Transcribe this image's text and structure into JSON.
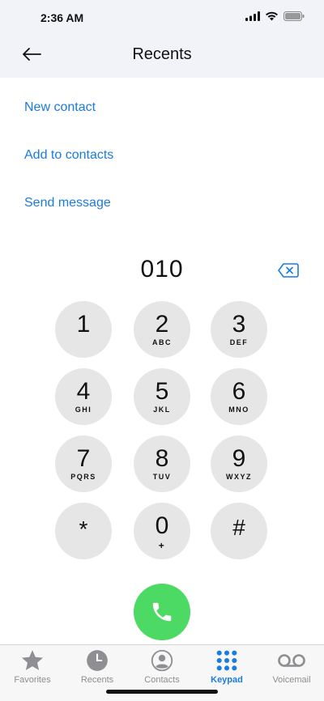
{
  "status_bar": {
    "time": "2:36 AM"
  },
  "nav": {
    "title": "Recents"
  },
  "actions": {
    "new_contact": "New contact",
    "add_to_contacts": "Add to contacts",
    "send_message": "Send message"
  },
  "dialer": {
    "entered_number": "010"
  },
  "keypad": {
    "k1": {
      "digit": "1",
      "letters": ""
    },
    "k2": {
      "digit": "2",
      "letters": "ABC"
    },
    "k3": {
      "digit": "3",
      "letters": "DEF"
    },
    "k4": {
      "digit": "4",
      "letters": "GHI"
    },
    "k5": {
      "digit": "5",
      "letters": "JKL"
    },
    "k6": {
      "digit": "6",
      "letters": "MNO"
    },
    "k7": {
      "digit": "7",
      "letters": "PQRS"
    },
    "k8": {
      "digit": "8",
      "letters": "TUV"
    },
    "k9": {
      "digit": "9",
      "letters": "WXYZ"
    },
    "kstar": {
      "digit": "*",
      "letters": ""
    },
    "k0": {
      "digit": "0",
      "letters": "+"
    },
    "khash": {
      "digit": "#",
      "letters": ""
    }
  },
  "tabs": {
    "favorites": "Favorites",
    "recents": "Recents",
    "contacts": "Contacts",
    "keypad": "Keypad",
    "voicemail": "Voicemail"
  },
  "colors": {
    "accent": "#1a7be0",
    "call_green": "#4cd964",
    "key_gray": "#e6e6e6",
    "header_bg": "#f1f3f8"
  }
}
